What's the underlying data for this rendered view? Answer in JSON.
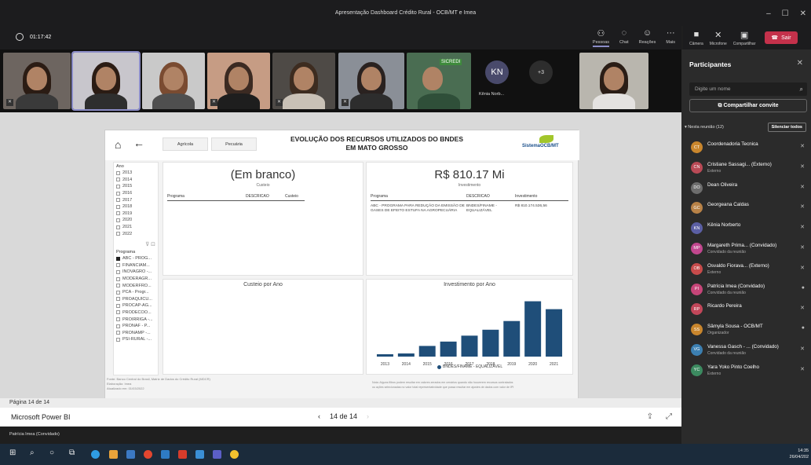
{
  "window": {
    "title": "Apresentação Dashboard Crédito Rural - OCB/MT e Imea",
    "controls": [
      "–",
      "☐",
      "✕"
    ]
  },
  "meeting": {
    "timer": "01:17:42",
    "tools": [
      {
        "icon": "people-icon",
        "glyph": "⚇",
        "label": "Pessoas"
      },
      {
        "icon": "chat-icon",
        "glyph": "◌",
        "label": "Chat"
      },
      {
        "icon": "reactions-icon",
        "glyph": "☺",
        "label": "Reações"
      },
      {
        "icon": "more-icon",
        "glyph": "···",
        "label": "Mais"
      }
    ],
    "controls": [
      {
        "icon": "camera-icon",
        "glyph": "■",
        "label": "Câmera"
      },
      {
        "icon": "microphone-icon",
        "glyph": "✕",
        "label": "Microfone"
      },
      {
        "icon": "share-tray-icon",
        "glyph": "▣",
        "label": "Compartilhar"
      }
    ],
    "leave_label": "Sair",
    "tile_initials": "KN",
    "tile_name": "Kênia Norb...",
    "overflow": "+3",
    "sicredi_label": "SICREDI"
  },
  "report": {
    "tabs": [
      "Agrícola",
      "Pecuária"
    ],
    "title_line1": "EVOLUÇÃO DOS RECURSOS UTILIZADOS DO BNDES",
    "title_line2": "EM MATO GROSSO",
    "logo_text": "SistemaOCB/MT",
    "year_filter_title": "Ano",
    "years": [
      "2013",
      "2014",
      "2015",
      "2016",
      "2017",
      "2018",
      "2019",
      "2020",
      "2021",
      "2022"
    ],
    "program_filter_title": "Programa",
    "programs": [
      "ABC - PROG...",
      "FINANCIAM...",
      "INOVAGRO -...",
      "MODERAGR...",
      "MODERFRO...",
      "PCA - Progr...",
      "PROAQUICU...",
      "PROCAP-AG...",
      "PRODECOO...",
      "PROIRRIGA -...",
      "PRONAF - P...",
      "PRONAMP -...",
      "PSI-RURAL -..."
    ],
    "kpi_left": {
      "value": "(Em branco)",
      "label": "Custeio"
    },
    "kpi_right": {
      "value": "R$ 810.17 Mi",
      "label": "Investimento"
    },
    "table_left": {
      "headers": [
        "Programa",
        "DESCRICAO",
        "Custeio"
      ]
    },
    "table_right": {
      "headers": [
        "Programa",
        "DESCRICAO",
        "Investimento"
      ],
      "row": {
        "programa": "ABC - PROGRAMA PARA REDUÇÃO DA EMISSÃO DE GASES DE EFEITO ESTUFA NA AGROPECUÁRIA",
        "descricao": "BNDES/FINAME - EQUALIZÁVEL",
        "investimento": "R$ 810.174.536,56"
      }
    },
    "chart_left_title": "Custeio por Ano",
    "footer_left": [
      "Fonte: Banco Central do Brasil, Matriz de Dados do Crédito Rural (MDCR)",
      "Elaboração: Imea",
      "Atualizado em: 01/03/2022"
    ],
    "footer_right": [
      "Nota: Alguns filtros podem resultar em valores zerados em cenários quando não houverem recursos contratados",
      "ou ações selecionadas no valor total representatividade que possa resultar em ajustes de dados com valor de IPI"
    ]
  },
  "chart_data": {
    "type": "bar",
    "title": "Investimento por Ano",
    "categories": [
      "2013",
      "2014",
      "2015",
      "2016",
      "2017",
      "2018",
      "2019",
      "2020",
      "2021"
    ],
    "series": [
      {
        "name": "BNDES/FINAME - EQUALIZÁVEL",
        "values": [
          0.06,
          0.08,
          0.27,
          0.38,
          0.53,
          0.68,
          0.9,
          1.4,
          1.2
        ]
      }
    ],
    "ylim": [
      0,
      1.55
    ],
    "grid": false,
    "legend": "bottom",
    "color": "#1f4e79"
  },
  "pbi_nav": {
    "page_indicator": "Página 14 de 14",
    "app_name": "Microsoft Power BI",
    "pager": "14 de 14",
    "prev": "‹",
    "next": "›"
  },
  "presenter": "Patrícia Imea (Convidado)",
  "participants_panel": {
    "title": "Participantes",
    "search_placeholder": "Digite um nome",
    "share_label": "Compartilhar convite",
    "section": "Nesta reunião (12)",
    "mute_all": "Silenciar todos",
    "people": [
      {
        "initials": "CT",
        "name": "Coordenadoria Tecnica",
        "sub": "",
        "color": "#c9862d",
        "mic": "✕"
      },
      {
        "initials": "CN",
        "name": "Cristiane Sassagi... (Externo)",
        "sub": "Externo",
        "color": "#b94a56",
        "mic": "✕"
      },
      {
        "initials": "DO",
        "name": "Dean Oliveira",
        "sub": "",
        "color": "#6d6d6d",
        "mic": "✕"
      },
      {
        "initials": "GC",
        "name": "Georgeana Caldas",
        "sub": "",
        "color": "#b88247",
        "mic": "✕"
      },
      {
        "initials": "KN",
        "name": "Kênia Norberto",
        "sub": "",
        "color": "#5b5fa4",
        "mic": "✕"
      },
      {
        "initials": "MP",
        "name": "Margareth Prima... (Convidado)",
        "sub": "Convidado da reunião",
        "color": "#c2478e",
        "mic": "✕"
      },
      {
        "initials": "OB",
        "name": "Osvaldo Fiorava... (Externo)",
        "sub": "Externo",
        "color": "#c74b4b",
        "mic": "✕"
      },
      {
        "initials": "PI",
        "name": "Patrícia Imea (Convidado)",
        "sub": "Convidado da reunião",
        "color": "#c64578",
        "mic": "●"
      },
      {
        "initials": "RP",
        "name": "Ricardo Pereira",
        "sub": "",
        "color": "#c2475a",
        "mic": "✕"
      },
      {
        "initials": "SS",
        "name": "Sâmyla Sousa - OCB/MT",
        "sub": "Organizador",
        "color": "#c9862d",
        "mic": "●"
      },
      {
        "initials": "VG",
        "name": "Vanessa Gasch - ... (Convidado)",
        "sub": "Convidado da reunião",
        "color": "#3c7fb1",
        "mic": "✕"
      },
      {
        "initials": "YC",
        "name": "Yara Yoko Pinto Coelho",
        "sub": "Externo",
        "color": "#3c8a60",
        "mic": "✕"
      }
    ]
  },
  "taskbar": {
    "time": "14:35",
    "date": "26/04/202"
  }
}
